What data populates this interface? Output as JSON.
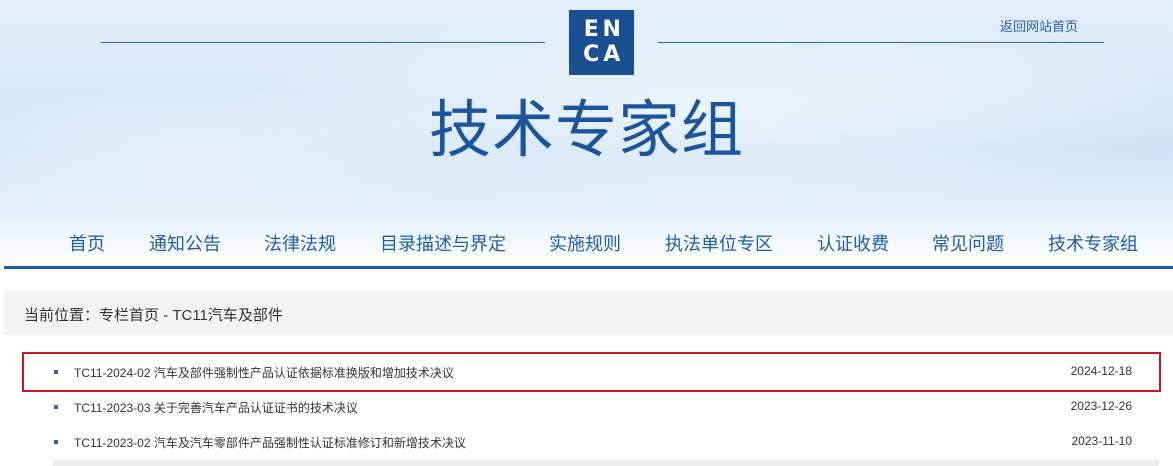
{
  "header": {
    "logo_letters": [
      "E",
      "N",
      "C",
      "A"
    ],
    "home_link": "返回网站首页",
    "title": "技术专家组"
  },
  "nav": {
    "items": [
      "首页",
      "通知公告",
      "法律法规",
      "目录描述与界定",
      "实施规则",
      "执法单位专区",
      "认证收费",
      "常见问题",
      "技术专家组"
    ]
  },
  "breadcrumb": {
    "text": "当前位置：专栏首页 - TC11汽车及部件"
  },
  "list": {
    "items": [
      {
        "title": "TC11-2024-02 汽车及部件强制性产品认证依据标准换版和增加技术决议",
        "date": "2024-12-18",
        "highlighted": true
      },
      {
        "title": "TC11-2023-03 关于完善汽车产品认证证书的技术决议",
        "date": "2023-12-26",
        "highlighted": false
      },
      {
        "title": "TC11-2023-02 汽车及汽车零部件产品强制性认证标准修订和新增技术决议",
        "date": "2023-11-10",
        "highlighted": false
      }
    ]
  },
  "colors": {
    "brand_blue": "#1b4f93",
    "nav_text": "#1f5ea8",
    "highlight_box": "#d0161c"
  }
}
